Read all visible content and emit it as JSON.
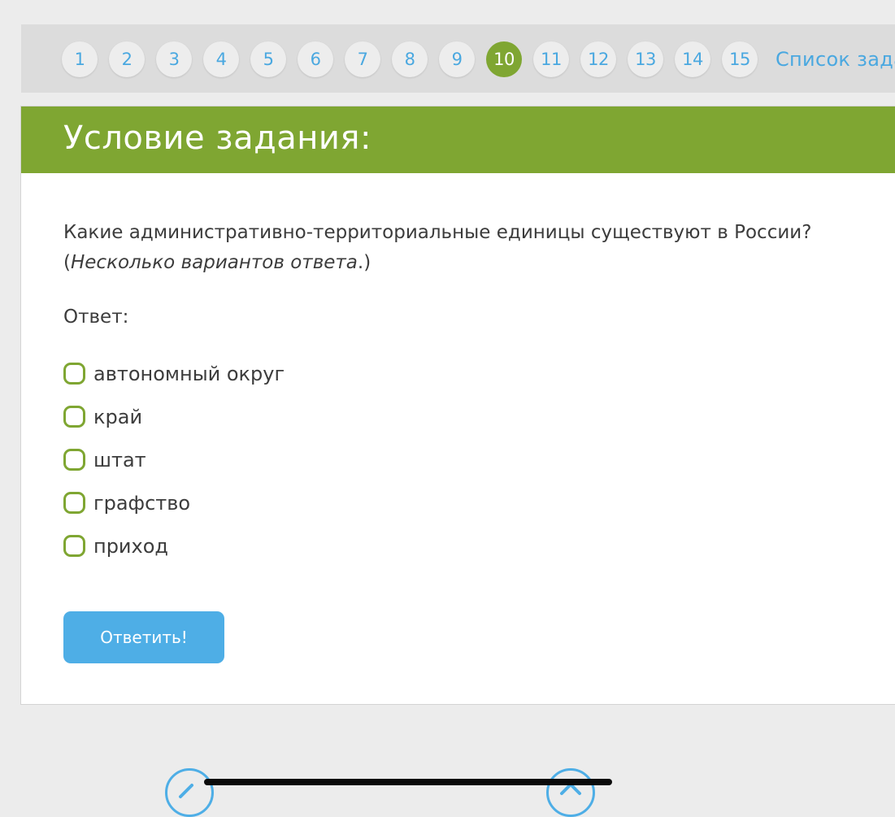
{
  "pagination": {
    "pages": [
      "1",
      "2",
      "3",
      "4",
      "5",
      "6",
      "7",
      "8",
      "9",
      "10",
      "11",
      "12",
      "13",
      "14",
      "15"
    ],
    "active_page": "10",
    "task_list_label": "Список зада"
  },
  "task": {
    "header_title": "Условие задания:",
    "question_text": "Какие административно-территориальные единицы существуют в России?",
    "question_note_open": "(",
    "question_note": "Несколько вариантов ответа",
    "question_note_close": ".)",
    "answer_label": "Ответ:",
    "options": [
      {
        "label": "автономный округ",
        "checked": false
      },
      {
        "label": "край",
        "checked": false
      },
      {
        "label": "штат",
        "checked": false
      },
      {
        "label": "графство",
        "checked": false
      },
      {
        "label": "приход",
        "checked": false
      }
    ],
    "submit_label": "Ответить!"
  },
  "bottom_nav": {
    "left_icon": "edit-icon",
    "right_icon": "up-arrow-icon"
  },
  "colors": {
    "accent_green": "#7fa632",
    "link_blue": "#4aa8e0",
    "button_blue": "#4eaee6"
  }
}
